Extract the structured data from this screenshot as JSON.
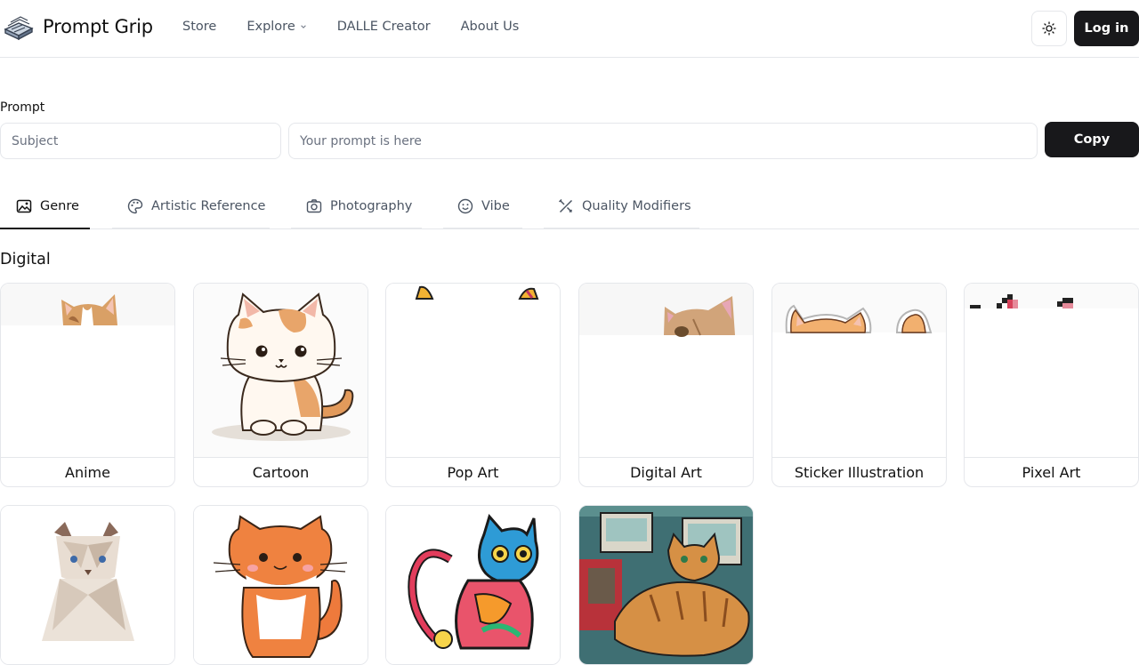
{
  "header": {
    "brand": "Prompt Grip",
    "nav": [
      {
        "label": "Store"
      },
      {
        "label": "Explore",
        "has_dropdown": true
      },
      {
        "label": "DALLE Creator"
      },
      {
        "label": "About Us"
      }
    ],
    "theme_icon": "sun-icon",
    "login_label": "Log in"
  },
  "prompt": {
    "label": "Prompt",
    "subject_placeholder": "Subject",
    "prompt_placeholder": "Your prompt is here",
    "copy_label": "Copy"
  },
  "tabs": [
    {
      "label": "Genre",
      "icon": "genre-image-icon",
      "active": true
    },
    {
      "label": "Artistic Reference",
      "icon": "palette-icon",
      "active": false
    },
    {
      "label": "Photography",
      "icon": "camera-icon",
      "active": false
    },
    {
      "label": "Vibe",
      "icon": "smiley-icon",
      "active": false
    },
    {
      "label": "Quality Modifiers",
      "icon": "tools-icon",
      "active": false
    }
  ],
  "section": {
    "title": "Digital",
    "cards_row1": [
      {
        "label": "Anime"
      },
      {
        "label": "Cartoon"
      },
      {
        "label": "Pop Art"
      },
      {
        "label": "Digital Art"
      },
      {
        "label": "Sticker Illustration"
      },
      {
        "label": "Pixel Art"
      }
    ],
    "cards_row2": [
      {
        "image": "low-poly-cat"
      },
      {
        "image": "cute-orange-cat"
      },
      {
        "image": "abstract-colorful-cat"
      },
      {
        "image": "comic-cat-at-desk"
      }
    ]
  },
  "colors": {
    "primary_button": "#18181b",
    "border": "#e5e7eb",
    "muted_text": "#4b5563"
  }
}
